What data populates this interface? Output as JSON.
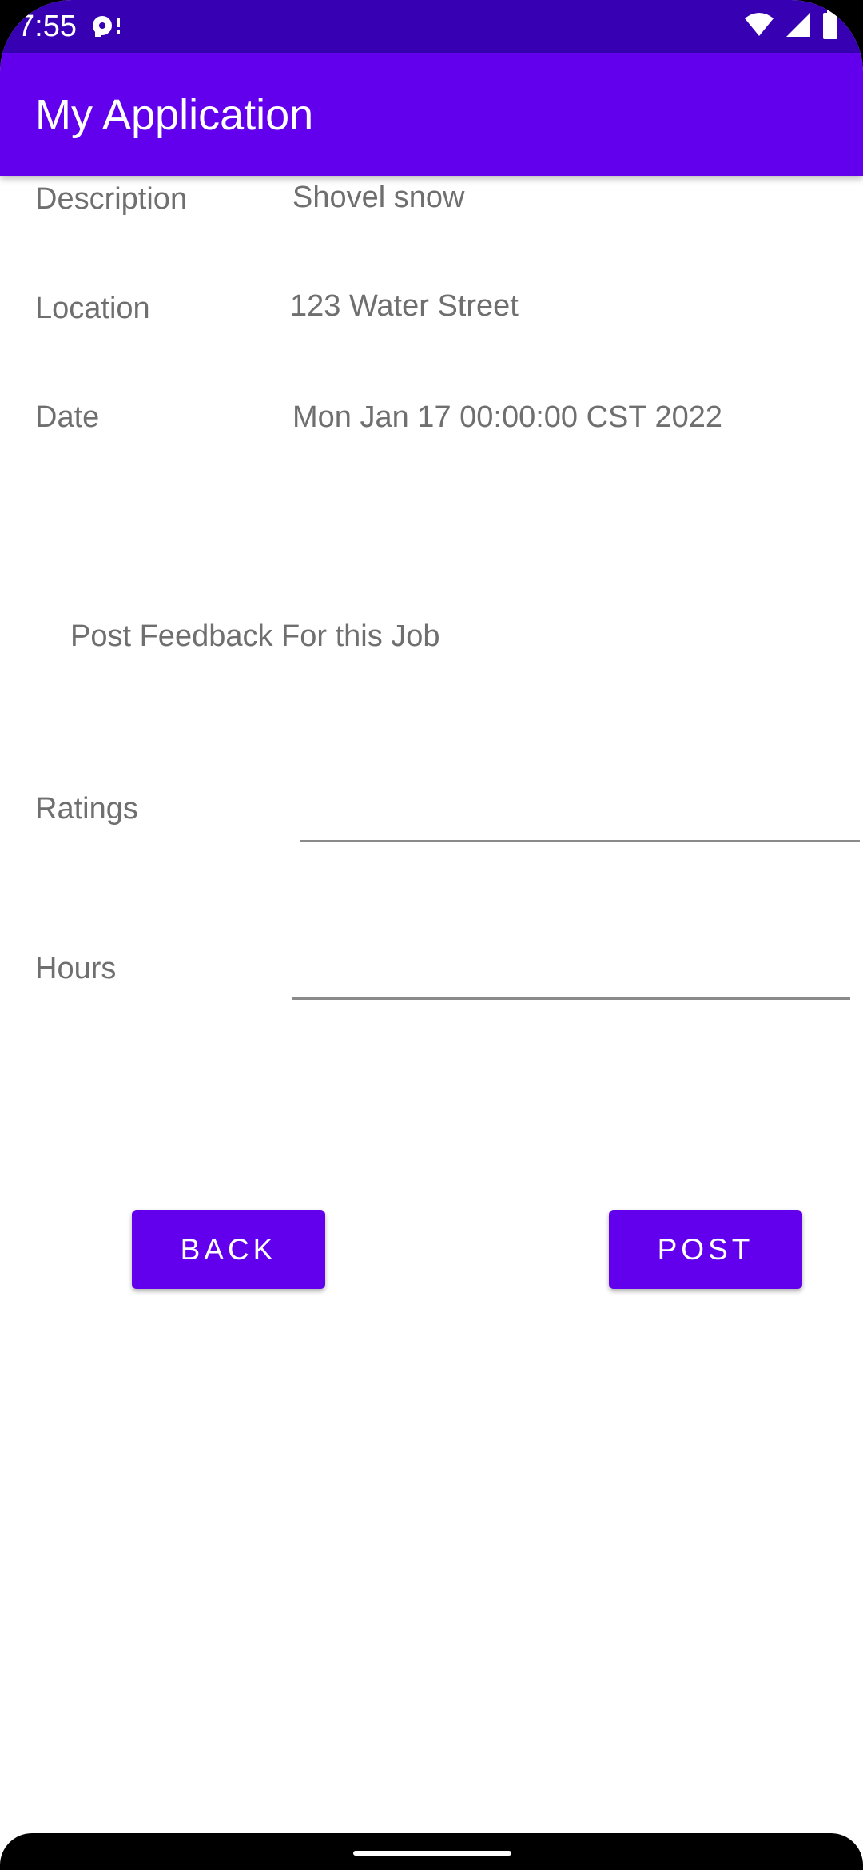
{
  "status_bar": {
    "time": "7:55"
  },
  "app_bar": {
    "title": "My Application"
  },
  "details": {
    "description_label": "Description",
    "description_value": "Shovel snow",
    "location_label": "Location",
    "location_value": "123 Water Street",
    "date_label": "Date",
    "date_value": "Mon Jan 17 00:00:00 CST 2022"
  },
  "feedback": {
    "heading": "Post Feedback For this Job",
    "ratings_label": "Ratings",
    "ratings_value": "",
    "hours_label": "Hours",
    "hours_value": ""
  },
  "actions": {
    "back_label": "BACK",
    "post_label": "POST"
  },
  "colors": {
    "status_bar": "#3700b3",
    "primary": "#6200ee",
    "text_secondary": "#6f6f6f"
  },
  "icons": [
    "notification-icon",
    "wifi-icon",
    "cell-signal-icon",
    "battery-icon"
  ]
}
